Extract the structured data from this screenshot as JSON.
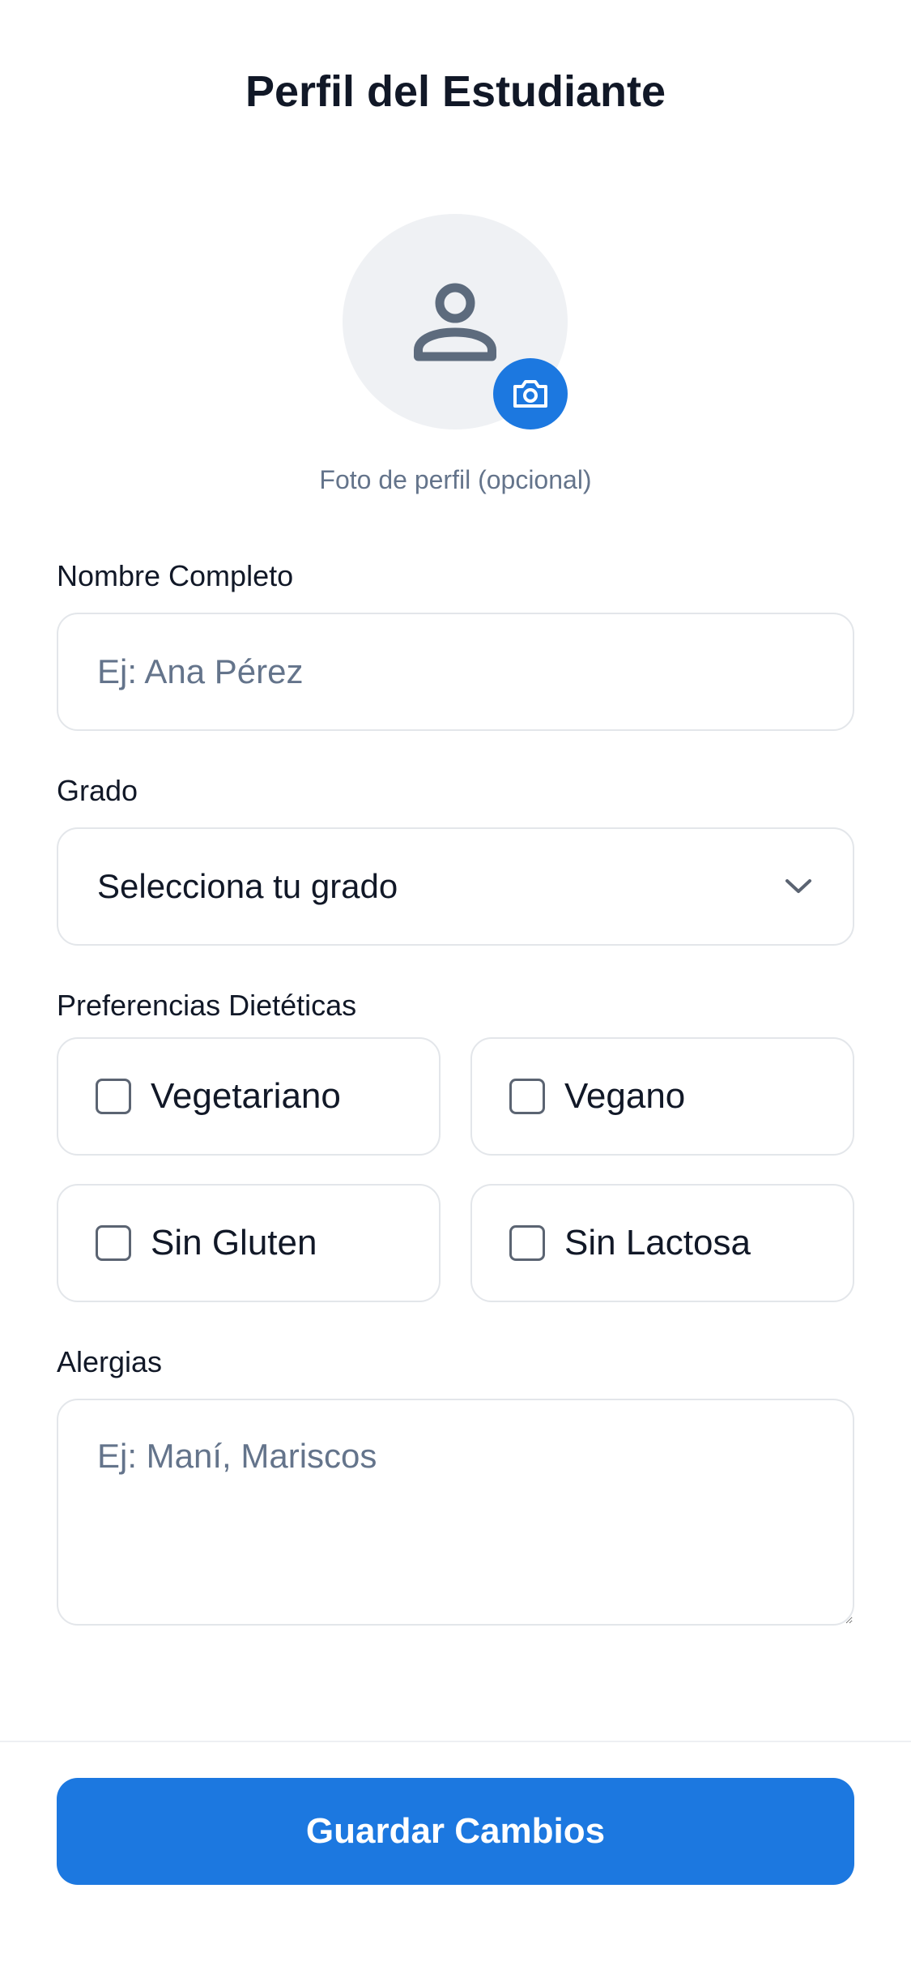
{
  "header": {
    "title": "Perfil del Estudiante"
  },
  "avatar": {
    "icon": "user-icon",
    "action_icon": "camera-icon",
    "caption": "Foto de perfil (opcional)"
  },
  "form": {
    "name": {
      "label": "Nombre Completo",
      "value": "",
      "placeholder": "Ej: Ana Pérez"
    },
    "grade": {
      "label": "Grado",
      "selected": "Selecciona tu grado",
      "icon": "chevron-down-icon"
    },
    "diet": {
      "label": "Preferencias Dietéticas",
      "options": [
        {
          "label": "Vegetariano",
          "checked": false
        },
        {
          "label": "Vegano",
          "checked": false
        },
        {
          "label": "Sin Gluten",
          "checked": false
        },
        {
          "label": "Sin Lactosa",
          "checked": false
        }
      ]
    },
    "allergies": {
      "label": "Alergias",
      "value": "",
      "placeholder": "Ej: Maní, Mariscos"
    }
  },
  "footer": {
    "save_label": "Guardar Cambios"
  },
  "colors": {
    "accent": "#1c78e0",
    "border": "#e3e6ea",
    "muted_text": "#64748b",
    "avatar_bg": "#eff1f4"
  }
}
